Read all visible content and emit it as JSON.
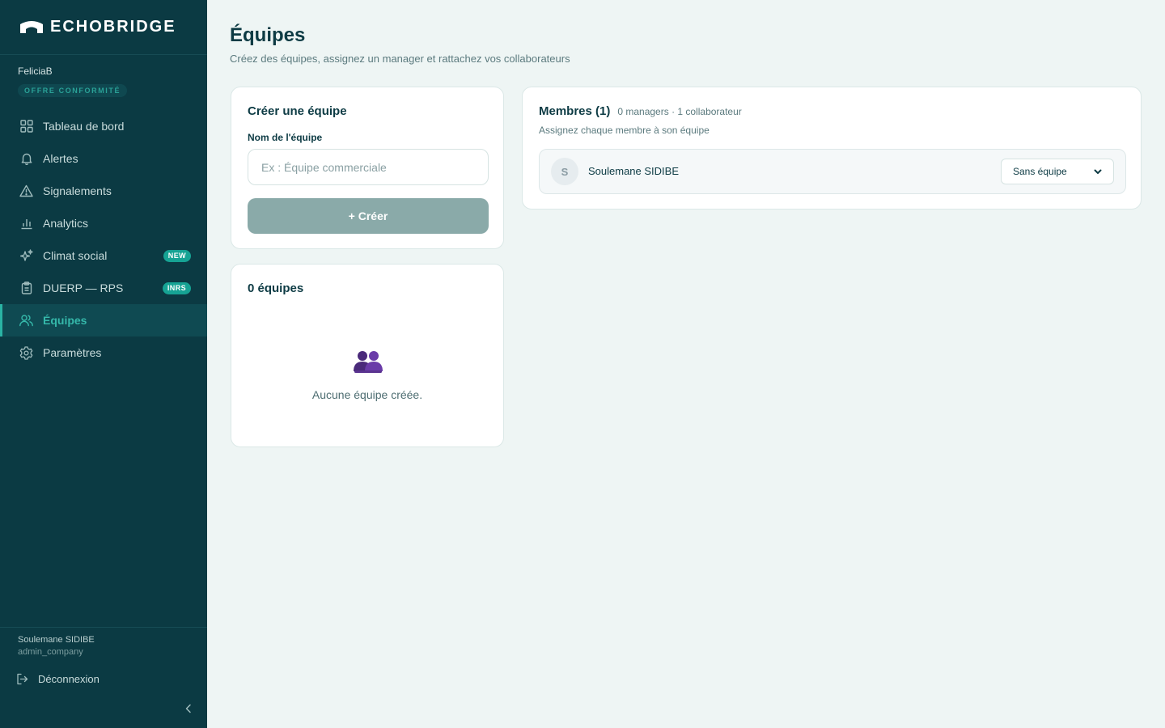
{
  "brand": {
    "name": "ECHOBRIDGE",
    "logo_icon": "arch-logo-icon"
  },
  "sidebar": {
    "org_name": "FeliciaB",
    "plan_badge": "OFFRE CONFORMITÉ",
    "items": [
      {
        "label": "Tableau de bord",
        "icon": "grid-icon"
      },
      {
        "label": "Alertes",
        "icon": "bell-icon"
      },
      {
        "label": "Signalements",
        "icon": "warning-icon"
      },
      {
        "label": "Analytics",
        "icon": "bar-chart-icon"
      },
      {
        "label": "Climat social",
        "icon": "sparkles-icon",
        "badge": "NEW"
      },
      {
        "label": "DUERP — RPS",
        "icon": "clipboard-icon",
        "badge": "INRS"
      },
      {
        "label": "Équipes",
        "icon": "users-icon",
        "active": true
      },
      {
        "label": "Paramètres",
        "icon": "gear-icon"
      }
    ],
    "user": {
      "name": "Soulemane SIDIBE",
      "role": "admin_company"
    },
    "logout_label": "Déconnexion"
  },
  "page": {
    "title": "Équipes",
    "subtitle": "Créez des équipes, assignez un manager et rattachez vos collaborateurs"
  },
  "create_card": {
    "title": "Créer une équipe",
    "field_label": "Nom de l'équipe",
    "placeholder": "Ex : Équipe commerciale",
    "value": "",
    "button_label": "+ Créer"
  },
  "teams_card": {
    "title": "0 équipes",
    "empty_icon": "people-icon",
    "empty_text": "Aucune équipe créée."
  },
  "members_card": {
    "title": "Membres (1)",
    "stats": "0 managers · 1 collaborateur",
    "subtitle": "Assignez chaque membre à son équipe",
    "members": [
      {
        "initial": "S",
        "name": "Soulemane SIDIBE",
        "team": "Sans équipe"
      }
    ]
  },
  "colors": {
    "sidebar_bg": "#0b3a43",
    "accent": "#2ab3a4",
    "page_bg": "#eef5f4",
    "button_disabled": "#8aaaa9"
  }
}
